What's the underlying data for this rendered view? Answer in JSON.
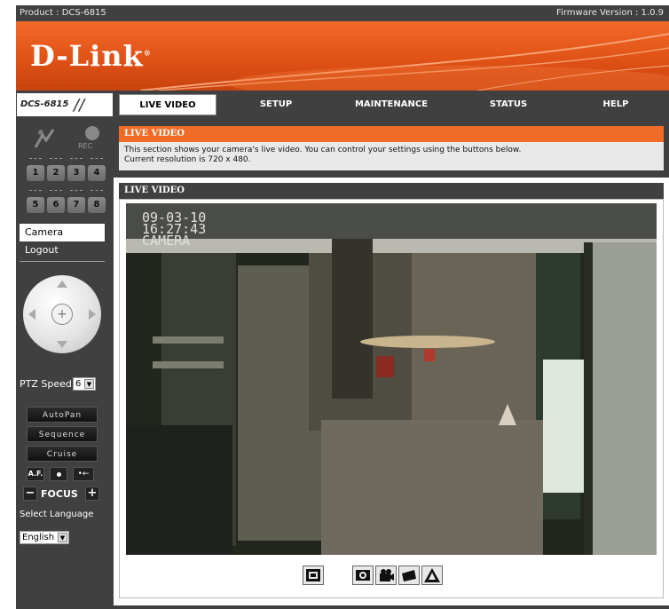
{
  "topbar": {
    "product": "Product : DCS-6815",
    "firmware": "Firmware Version : 1.0.9"
  },
  "brand": {
    "logo": "D-Link"
  },
  "nav": {
    "model": "DCS-6815",
    "tabs": [
      "LIVE VIDEO",
      "SETUP",
      "MAINTENANCE",
      "STATUS",
      "HELP"
    ],
    "active_tab": "LIVE VIDEO"
  },
  "sidebar": {
    "rec_label": "REC",
    "cameras": [
      "1",
      "2",
      "3",
      "4",
      "5",
      "6",
      "7",
      "8"
    ],
    "links": [
      "Camera",
      "Logout"
    ],
    "ptz_speed_label": "PTZ Speed",
    "ptz_speed_value": "6",
    "buttons": [
      "AutoPan",
      "Sequence",
      "Cruise"
    ],
    "af_label": "A.F.",
    "focus_label": "FOCUS",
    "language_label": "Select Language",
    "language_value": "English"
  },
  "main": {
    "info_title": "LIVE VIDEO",
    "info_line1": "This section shows your camera's live video. You can control your settings using the buttons below.",
    "info_line2": "Current resolution is 720 x 480.",
    "video_title": "LIVE VIDEO",
    "osd_date": "09-03-10",
    "osd_time": "16:27:43",
    "osd_name": "CAMERA"
  },
  "icons": [
    "fullscreen-icon",
    "snapshot-icon",
    "record-icon",
    "folder-icon",
    "alarm-icon"
  ],
  "colors": {
    "accent": "#ef6b26",
    "frame": "#404040"
  }
}
